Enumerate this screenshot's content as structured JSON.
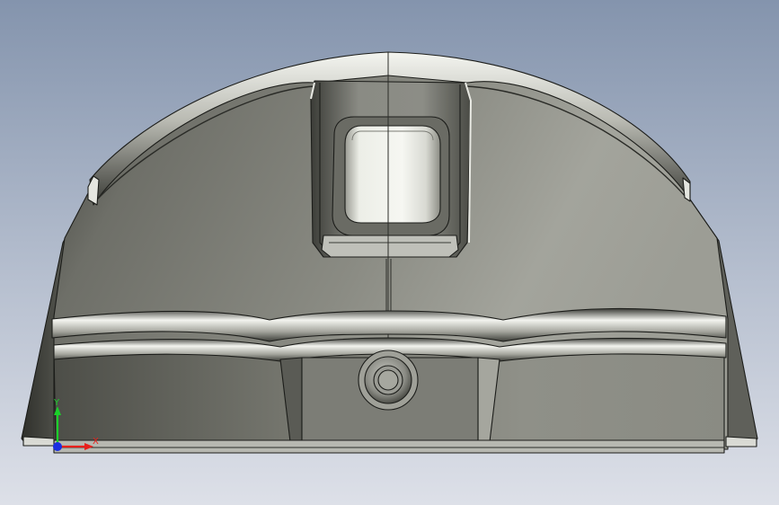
{
  "viewport": {
    "background_top": "#8494ad",
    "background_bottom": "#d9dde6"
  },
  "model": {
    "body_color": "#7e7f76",
    "highlight_color": "#f2f3ee",
    "edge_color": "#1c1d1a",
    "button_color": "#e4e5de"
  },
  "triad": {
    "x_label": "X",
    "y_label": "Y",
    "x_color": "#e8201c",
    "y_color": "#1bd02a",
    "z_color": "#1a2ee0"
  }
}
